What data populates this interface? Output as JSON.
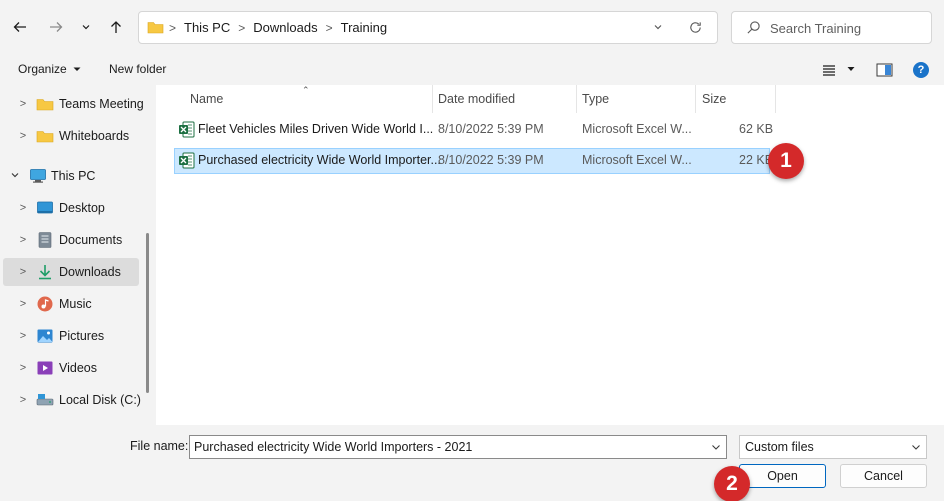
{
  "address": {
    "crumbs": [
      "This PC",
      "Downloads",
      "Training"
    ]
  },
  "search": {
    "placeholder": "Search Training"
  },
  "toolbar": {
    "organize_label": "Organize",
    "new_folder_label": "New folder",
    "help_label": "?"
  },
  "sidebar": {
    "items": [
      {
        "label": "Teams Meeting",
        "icon": "folder-icon"
      },
      {
        "label": "Whiteboards",
        "icon": "folder-icon"
      },
      {
        "label": "This PC",
        "icon": "computer-icon"
      },
      {
        "label": "Desktop",
        "icon": "desktop-icon"
      },
      {
        "label": "Documents",
        "icon": "documents-icon"
      },
      {
        "label": "Downloads",
        "icon": "download-icon"
      },
      {
        "label": "Music",
        "icon": "music-icon"
      },
      {
        "label": "Pictures",
        "icon": "pictures-icon"
      },
      {
        "label": "Videos",
        "icon": "videos-icon"
      },
      {
        "label": "Local Disk (C:)",
        "icon": "drive-icon"
      }
    ]
  },
  "columns": [
    "Name",
    "Date modified",
    "Type",
    "Size"
  ],
  "files": [
    {
      "name": "Fleet Vehicles Miles Driven Wide World I...",
      "date": "8/10/2022 5:39 PM",
      "type": "Microsoft Excel W...",
      "size": "62 KB"
    },
    {
      "name": "Purchased electricity Wide World Importer...",
      "date": "8/10/2022 5:39 PM",
      "type": "Microsoft Excel W...",
      "size": "22 KB"
    }
  ],
  "badges": {
    "one": "1",
    "two": "2"
  },
  "bottom": {
    "file_name_label": "File name:",
    "file_name_value": "Purchased electricity Wide World Importers - 2021",
    "file_type_value": "Custom files",
    "open_label": "Open",
    "cancel_label": "Cancel"
  },
  "colors": {
    "selection": "#cce8ff",
    "badge": "#d4292a",
    "accent": "#0067c0",
    "excel_green": "#1d6f42"
  }
}
